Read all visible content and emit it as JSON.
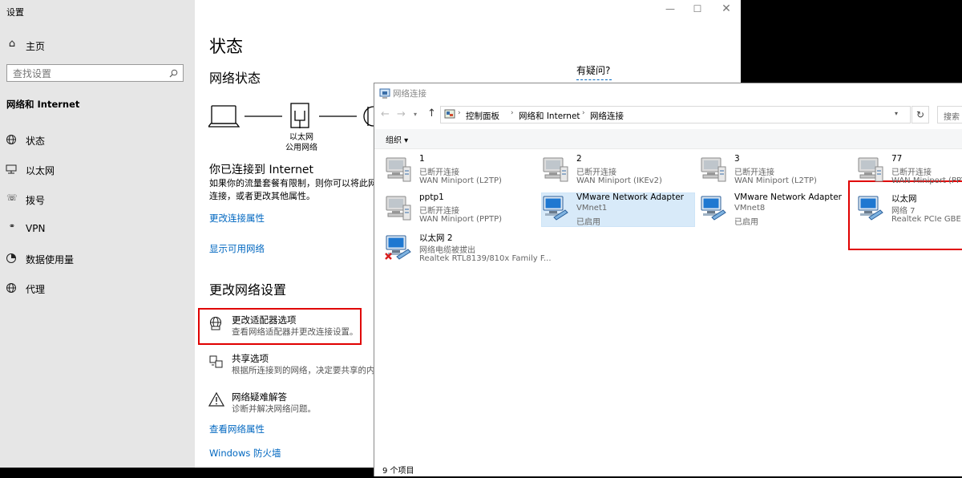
{
  "settings": {
    "window_title": "设置",
    "home_label": "主页",
    "search_placeholder": "查找设置",
    "category": "网络和 Internet",
    "nav": [
      {
        "label": "状态"
      },
      {
        "label": "以太网"
      },
      {
        "label": "拨号"
      },
      {
        "label": "VPN"
      },
      {
        "label": "数据使用量"
      },
      {
        "label": "代理"
      }
    ],
    "page_title": "状态",
    "network_status_heading": "网络状态",
    "diagram_label_1": "以太网",
    "diagram_label_2": "公用网络",
    "connected_text": "你已连接到 Internet",
    "desc_line1": "如果你的流量套餐有限制，则你可以将此网",
    "desc_line2": "连接，或者更改其他属性。",
    "link_change_props": "更改连接属性",
    "link_show_networks": "显示可用网络",
    "change_settings_heading": "更改网络设置",
    "adapter_title": "更改适配器选项",
    "adapter_sub": "查看网络适配器并更改连接设置。",
    "sharing_title": "共享选项",
    "sharing_sub": "根据所连接到的网络，决定要共享的内容",
    "troubleshoot_title": "网络疑难解答",
    "troubleshoot_sub": "诊断并解决网络问题。",
    "link_net_props": "查看网络属性",
    "link_firewall": "Windows 防火墙",
    "help_heading": "有疑问?"
  },
  "netwin": {
    "title": "网络连接",
    "breadcrumb": [
      "控制面板",
      "网络和 Internet",
      "网络连接"
    ],
    "search_placeholder": "搜索",
    "organize_label": "组织 ▾",
    "status_bar": "9 个项目",
    "connections": [
      {
        "name": "1",
        "line1": "已断开连接",
        "line2": "WAN Miniport (L2TP)"
      },
      {
        "name": "2",
        "line1": "已断开连接",
        "line2": "WAN Miniport (IKEv2)"
      },
      {
        "name": "3",
        "line1": "已断开连接",
        "line2": "WAN Miniport (L2TP)"
      },
      {
        "name": "77",
        "line1": "已断开连接",
        "line2": "WAN Miniport (PPTP)"
      },
      {
        "name": "pptp1",
        "line1": "已断开连接",
        "line2": "WAN Miniport (PPTP)"
      },
      {
        "name": "VMware Network Adapter",
        "line1": "VMnet1",
        "line2": "已启用"
      },
      {
        "name": "VMware Network Adapter",
        "line1": "VMnet8",
        "line2": "已启用"
      },
      {
        "name": "以太网",
        "line1": "网络 7",
        "line2": "Realtek PCIe GBE F..."
      },
      {
        "name": "以太网 2",
        "line1": "网络电缆被拔出",
        "line2": "Realtek RTL8139/810x Family F..."
      }
    ]
  }
}
